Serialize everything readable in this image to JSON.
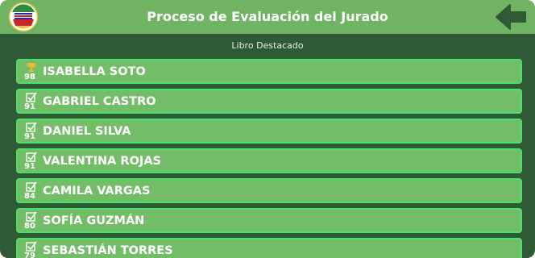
{
  "header": {
    "title": "Proceso de Evaluación del Jurado",
    "logo_icon": "club-emblem-icon",
    "back_icon": "arrow-left-icon"
  },
  "subtitle": "Libro Destacado",
  "colors": {
    "header_bg": "#6fb363",
    "page_bg": "#2f5a35",
    "row_bg": "#74bd68",
    "row_border": "#49e06a"
  },
  "entries": [
    {
      "name": "ISABELLA SOTO",
      "score": "98",
      "icon": "trophy-icon"
    },
    {
      "name": "GABRIEL CASTRO",
      "score": "91",
      "icon": "checkbox-checked-icon"
    },
    {
      "name": "DANIEL SILVA",
      "score": "91",
      "icon": "checkbox-checked-icon"
    },
    {
      "name": "VALENTINA ROJAS",
      "score": "91",
      "icon": "checkbox-checked-icon"
    },
    {
      "name": "CAMILA VARGAS",
      "score": "84",
      "icon": "checkbox-checked-icon"
    },
    {
      "name": "SOFÍA GUZMÁN",
      "score": "80",
      "icon": "checkbox-checked-icon"
    },
    {
      "name": "SEBASTIÁN TORRES",
      "score": "79",
      "icon": "checkbox-checked-icon"
    }
  ]
}
